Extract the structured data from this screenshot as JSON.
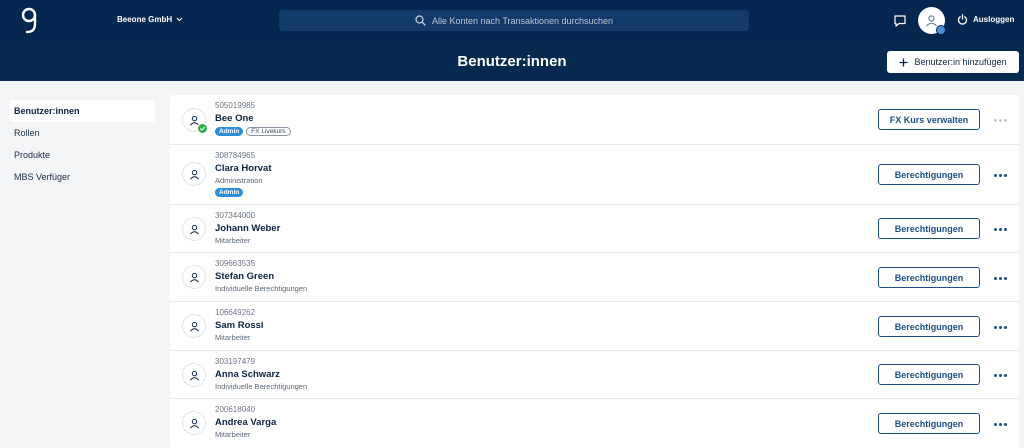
{
  "header": {
    "company": "Beeone GmbH",
    "search_placeholder": "Alle Konten nach Transaktionen durchsuchen",
    "logout_label": "Ausloggen"
  },
  "title_bar": {
    "title": "Benutzer:innen",
    "add_button_label": "Benutzer:in hinzufügen"
  },
  "sidebar": {
    "items": [
      {
        "label": "Benutzer:innen",
        "active": true
      },
      {
        "label": "Rollen",
        "active": false
      },
      {
        "label": "Produkte",
        "active": false
      },
      {
        "label": "MBS Verfüger",
        "active": false
      }
    ]
  },
  "users": [
    {
      "id": "505019985",
      "name": "Bee One",
      "role": "",
      "tags": [
        "Admin",
        "FX Livekurs"
      ],
      "action": "FX Kurs verwalten",
      "verified": true
    },
    {
      "id": "308784965",
      "name": "Clara Horvat",
      "role": "Administration",
      "tags": [
        "Admin"
      ],
      "action": "Berechtigungen",
      "verified": false
    },
    {
      "id": "307344000",
      "name": "Johann Weber",
      "role": "Mitarbeiter",
      "tags": [],
      "action": "Berechtigungen",
      "verified": false
    },
    {
      "id": "309663535",
      "name": "Stefan Green",
      "role": "Individuelle Berechtigungen",
      "tags": [],
      "action": "Berechtigungen",
      "verified": false
    },
    {
      "id": "106649262",
      "name": "Sam Rossi",
      "role": "Mitarbeiter",
      "tags": [],
      "action": "Berechtigungen",
      "verified": false
    },
    {
      "id": "303197479",
      "name": "Anna Schwarz",
      "role": "Individuelle Berechtigungen",
      "tags": [],
      "action": "Berechtigungen",
      "verified": false
    },
    {
      "id": "200618040",
      "name": "Andrea Varga",
      "role": "Mitarbeiter",
      "tags": [],
      "action": "Berechtigungen",
      "verified": false
    }
  ],
  "colors": {
    "header_bg": "#05264f",
    "accent": "#1e4e86",
    "admin_tag": "#2f8fd6",
    "verified": "#2fae48"
  }
}
